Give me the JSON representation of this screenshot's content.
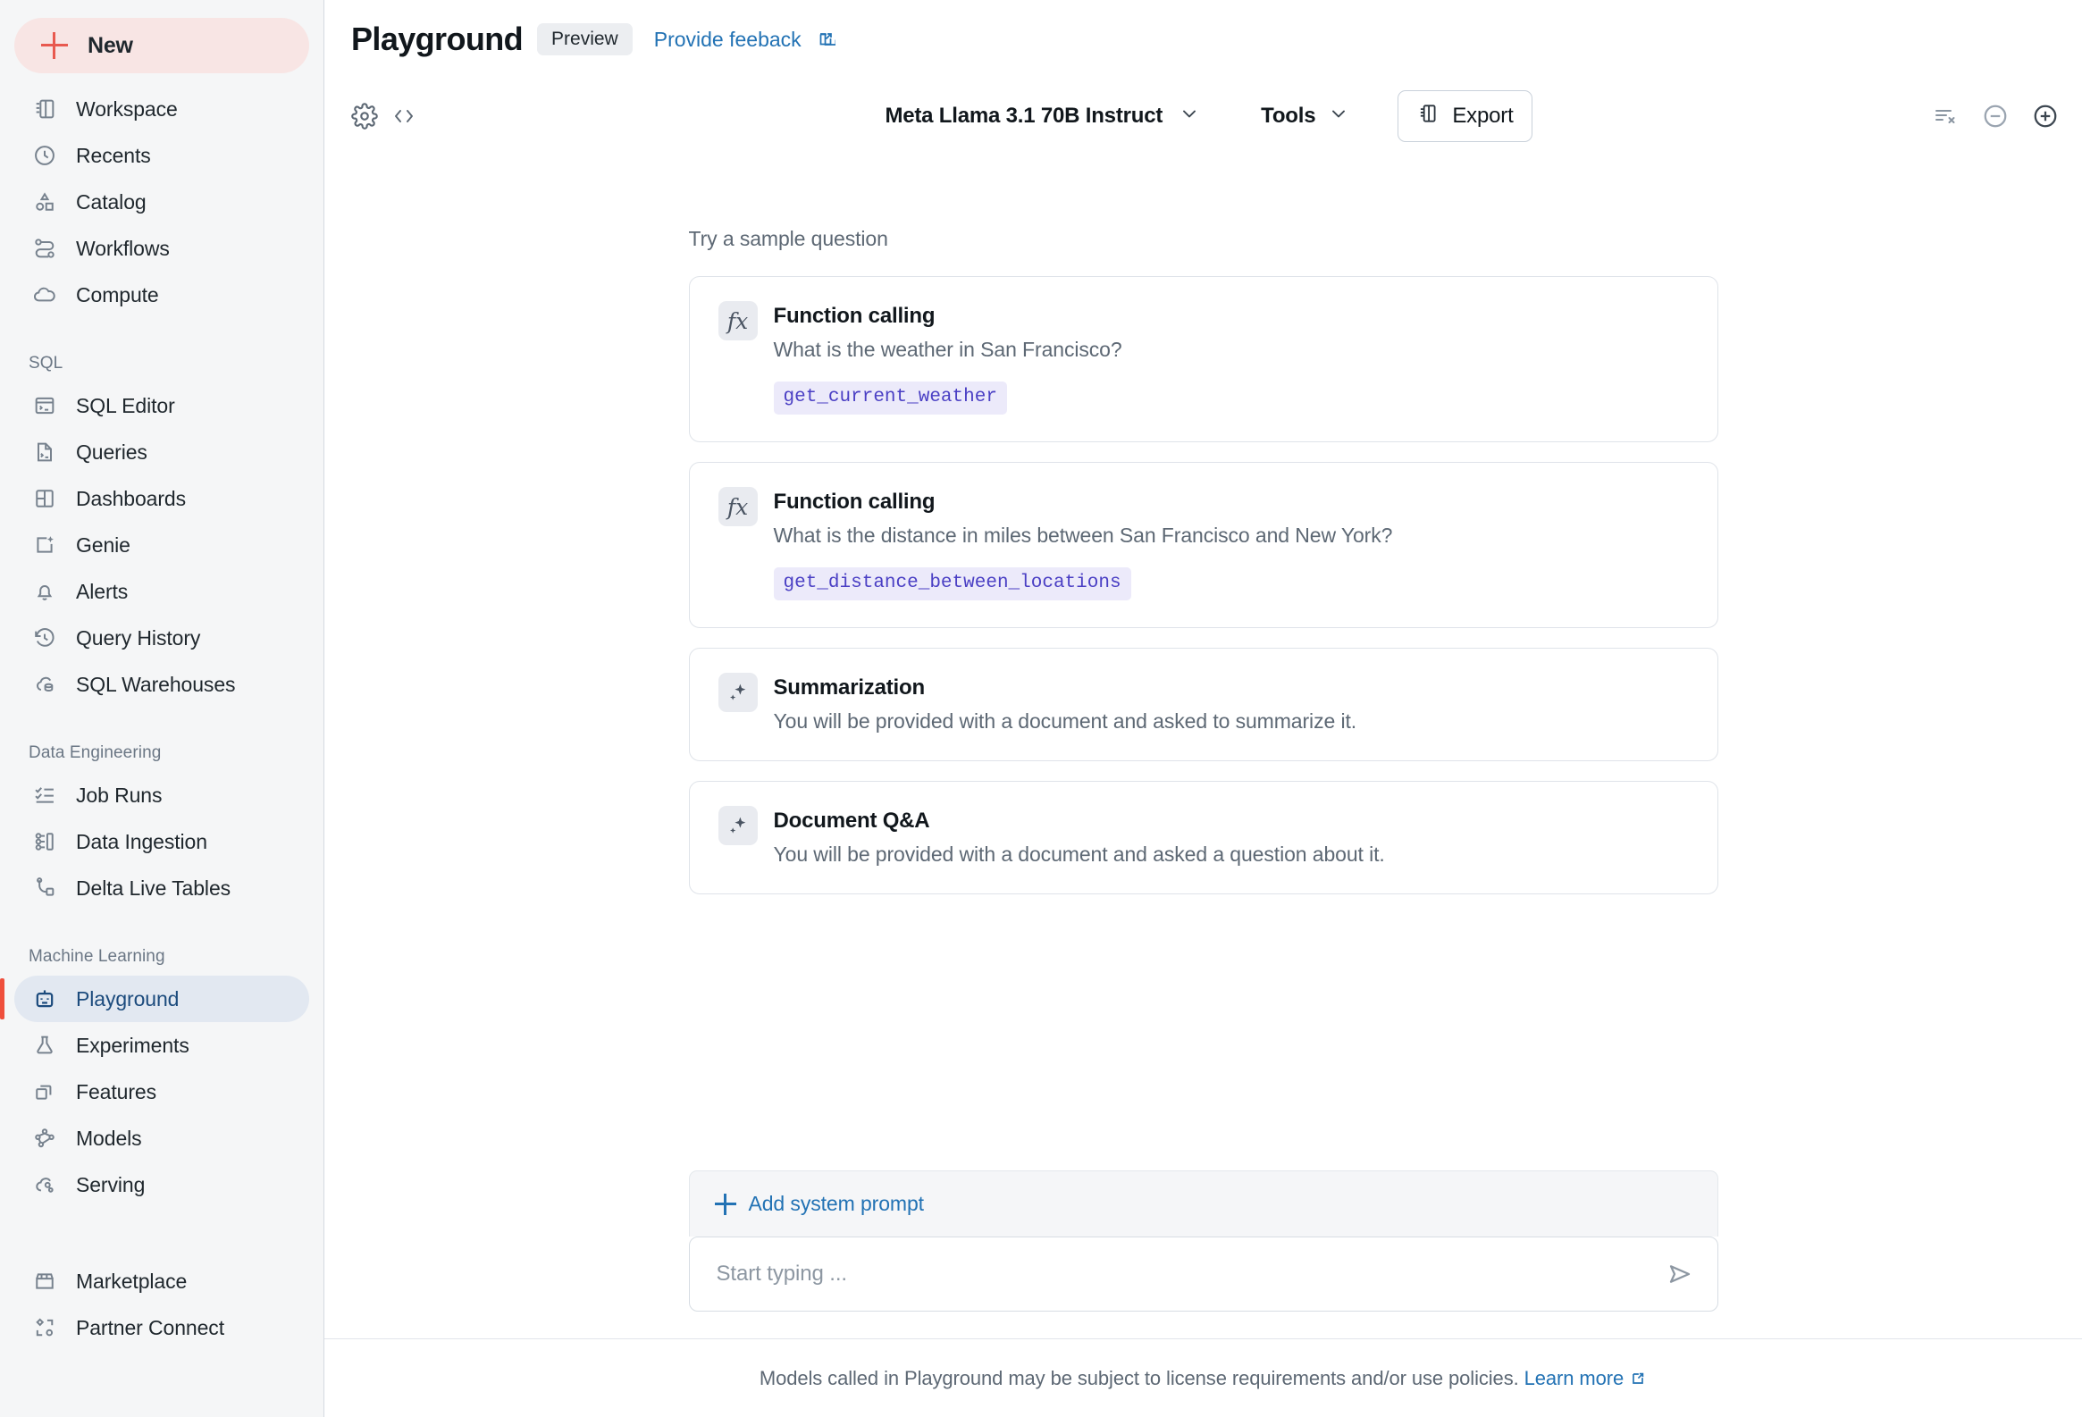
{
  "sidebar": {
    "new_button": {
      "label": "New",
      "icon": "plus-icon"
    },
    "primary_items": [
      {
        "label": "Workspace",
        "icon": "workspace-icon"
      },
      {
        "label": "Recents",
        "icon": "clock-icon"
      },
      {
        "label": "Catalog",
        "icon": "shapes-icon"
      },
      {
        "label": "Workflows",
        "icon": "workflow-icon"
      },
      {
        "label": "Compute",
        "icon": "cloud-icon"
      }
    ],
    "groups": [
      {
        "title": "SQL",
        "items": [
          {
            "label": "SQL Editor",
            "icon": "terminal-window-icon"
          },
          {
            "label": "Queries",
            "icon": "query-file-icon"
          },
          {
            "label": "Dashboards",
            "icon": "dashboard-grid-icon"
          },
          {
            "label": "Genie",
            "icon": "genie-sparkle-icon"
          },
          {
            "label": "Alerts",
            "icon": "bell-icon"
          },
          {
            "label": "Query History",
            "icon": "history-icon"
          },
          {
            "label": "SQL Warehouses",
            "icon": "warehouse-cloud-icon"
          }
        ]
      },
      {
        "title": "Data Engineering",
        "items": [
          {
            "label": "Job Runs",
            "icon": "checklist-icon"
          },
          {
            "label": "Data Ingestion",
            "icon": "ingestion-icon"
          },
          {
            "label": "Delta Live Tables",
            "icon": "pipeline-icon"
          }
        ]
      },
      {
        "title": "Machine Learning",
        "items": [
          {
            "label": "Playground",
            "icon": "robot-icon",
            "active": true
          },
          {
            "label": "Experiments",
            "icon": "flask-icon"
          },
          {
            "label": "Features",
            "icon": "layers-icon"
          },
          {
            "label": "Models",
            "icon": "model-graph-icon"
          },
          {
            "label": "Serving",
            "icon": "serving-cloud-icon"
          }
        ]
      }
    ],
    "bottom_items": [
      {
        "label": "Marketplace",
        "icon": "store-icon"
      },
      {
        "label": "Partner Connect",
        "icon": "partner-connect-icon"
      }
    ]
  },
  "header": {
    "title": "Playground",
    "badge": "Preview",
    "feedback_link": "Provide feeback",
    "feedback_icon": "external-link-icon"
  },
  "toolbar": {
    "settings_icon": "gear-icon",
    "code_icon": "code-brackets-icon",
    "model": "Meta Llama 3.1 70B Instruct",
    "model_chevron": "chevron-down-icon",
    "tools": "Tools",
    "tools_chevron": "chevron-down-icon",
    "export": "Export",
    "export_icon": "notebook-icon",
    "right_icons": [
      {
        "name": "clear-all-icon"
      },
      {
        "name": "remove-pane-icon"
      },
      {
        "name": "add-pane-icon"
      }
    ]
  },
  "main": {
    "sample_label": "Try a sample question",
    "cards": [
      {
        "icon": "fx-icon",
        "title": "Function calling",
        "description": "What is the weather in San Francisco?",
        "chip": "get_current_weather"
      },
      {
        "icon": "fx-icon",
        "title": "Function calling",
        "description": "What is the distance in miles between San Francisco and New York?",
        "chip": "get_distance_between_locations"
      },
      {
        "icon": "sparkle-icon",
        "title": "Summarization",
        "description": "You will be provided with a document and asked to summarize it."
      },
      {
        "icon": "sparkle-icon",
        "title": "Document Q&A",
        "description": "You will be provided with a document and asked a question about it."
      }
    ]
  },
  "composer": {
    "add_system_prompt": "Add system prompt",
    "add_icon": "plus-icon",
    "input_value": "",
    "input_placeholder": "Start typing ...",
    "send_icon": "send-icon"
  },
  "footer": {
    "text": "Models called in Playground may be subject to license requirements and/or use policies.",
    "link": "Learn more",
    "link_icon": "external-link-icon"
  },
  "colors": {
    "accent_red": "#ef4f3c",
    "new_button_bg": "#f8e5e4",
    "link_blue": "#2272b4",
    "active_item_bg": "#e2e8f1",
    "active_item_text": "#1c4b7d",
    "chip_bg": "#eceafa",
    "chip_text": "#4a3fc4",
    "sidebar_bg": "#f5f6f7"
  }
}
